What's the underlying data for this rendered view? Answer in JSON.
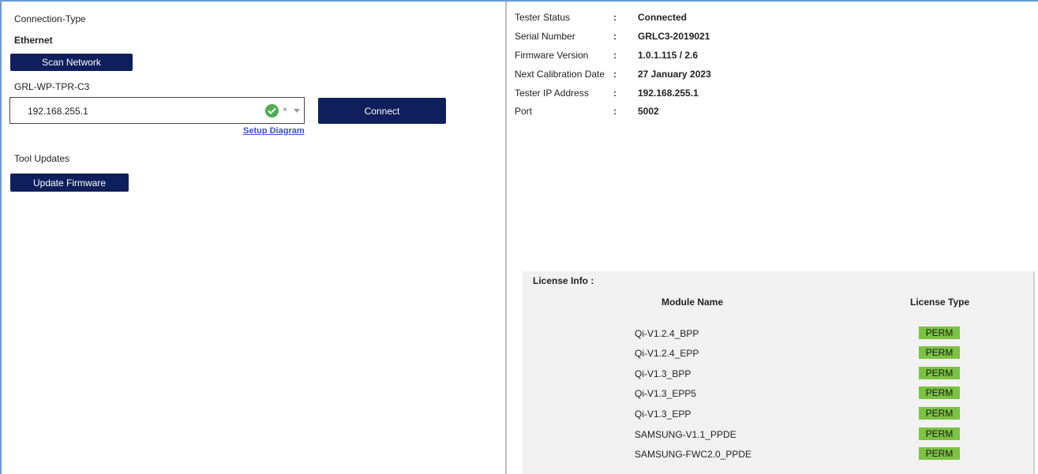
{
  "connection": {
    "type_label": "Connection-Type",
    "type_value": "Ethernet",
    "scan_button": "Scan Network",
    "device_name": "GRL-WP-TPR-C3",
    "ip_value": "192.168.255.1",
    "clear_glyph": "×",
    "connect_button": "Connect",
    "setup_link": "Setup Diagram"
  },
  "tools": {
    "title": "Tool Updates",
    "update_button": "Update Firmware"
  },
  "status": {
    "separator": ":",
    "rows": [
      {
        "key": "Tester Status",
        "value": "Connected"
      },
      {
        "key": "Serial Number",
        "value": "GRLC3-2019021"
      },
      {
        "key": "Firmware Version",
        "value": "1.0.1.115 / 2.6"
      },
      {
        "key": "Next Calibration Date",
        "value": "27 January 2023"
      },
      {
        "key": "Tester IP Address",
        "value": "192.168.255.1"
      },
      {
        "key": "Port",
        "value": "5002"
      }
    ]
  },
  "license": {
    "title": "License Info :",
    "col_module": "Module Name",
    "col_type": "License Type",
    "badge_color": "#7cc242",
    "rows": [
      {
        "module": "Qi-V1.2.4_BPP",
        "type": "PERM"
      },
      {
        "module": "Qi-V1.2.4_EPP",
        "type": "PERM"
      },
      {
        "module": "Qi-V1.3_BPP",
        "type": "PERM"
      },
      {
        "module": "Qi-V1.3_EPP5",
        "type": "PERM"
      },
      {
        "module": "Qi-V1.3_EPP",
        "type": "PERM"
      },
      {
        "module": "SAMSUNG-V1.1_PPDE",
        "type": "PERM"
      },
      {
        "module": "SAMSUNG-FWC2.0_PPDE",
        "type": "PERM"
      }
    ]
  },
  "icons": {
    "valid": "check-circle-icon",
    "clear": "close-icon",
    "dropdown": "chevron-down-icon"
  },
  "colors": {
    "button_bg": "#0f1f5c",
    "link": "#3a4fd0",
    "valid": "#4caf50",
    "frame": "#6a9ad0"
  }
}
